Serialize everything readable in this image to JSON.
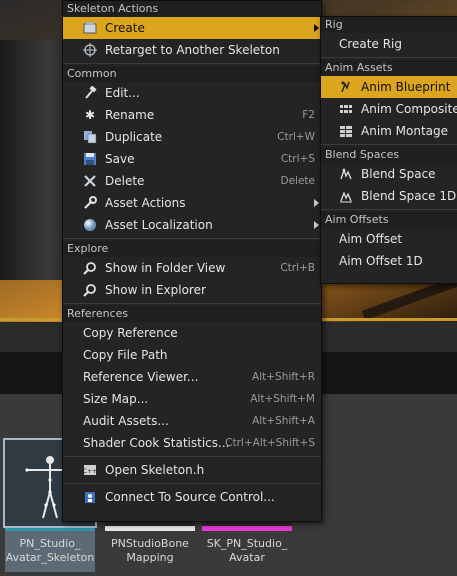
{
  "menu": {
    "sections": {
      "skeleton_actions": "Skeleton Actions",
      "common": "Common",
      "explore": "Explore",
      "references": "References"
    },
    "skeleton_actions": [
      {
        "label": "Create",
        "icon": "create-icon",
        "highlighted": true,
        "submenu": true
      },
      {
        "label": "Retarget to Another Skeleton",
        "icon": "crosshair-icon"
      }
    ],
    "common": [
      {
        "label": "Edit...",
        "icon": "hammer-icon",
        "shortcut": ""
      },
      {
        "label": "Rename",
        "icon": "asterisk-icon",
        "shortcut": "F2"
      },
      {
        "label": "Duplicate",
        "icon": "duplicate-icon",
        "shortcut": "Ctrl+W"
      },
      {
        "label": "Save",
        "icon": "save-icon",
        "shortcut": "Ctrl+S"
      },
      {
        "label": "Delete",
        "icon": "delete-icon",
        "shortcut": "Delete"
      },
      {
        "label": "Asset Actions",
        "icon": "wrench-icon",
        "submenu": true
      },
      {
        "label": "Asset Localization",
        "icon": "globe-icon",
        "submenu": true
      }
    ],
    "explore": [
      {
        "label": "Show in Folder View",
        "icon": "magnifier-icon",
        "shortcut": "Ctrl+B"
      },
      {
        "label": "Show in Explorer",
        "icon": "magnifier-icon",
        "shortcut": ""
      }
    ],
    "references": [
      {
        "label": "Copy Reference",
        "shortcut": ""
      },
      {
        "label": "Copy File Path",
        "shortcut": ""
      },
      {
        "label": "Reference Viewer...",
        "shortcut": "Alt+Shift+R"
      },
      {
        "label": "Size Map...",
        "shortcut": "Alt+Shift+M"
      },
      {
        "label": "Audit Assets...",
        "shortcut": "Alt+Shift+A"
      },
      {
        "label": "Shader Cook Statistics...",
        "shortcut": "Ctrl+Alt+Shift+S"
      }
    ],
    "open_header": {
      "label": "Open Skeleton.h",
      "icon": "cpp-file-icon"
    },
    "source_control": {
      "label": "Connect To Source Control...",
      "icon": "source-control-icon"
    }
  },
  "submenu": {
    "rig_header": "Rig",
    "rig_items": [
      {
        "label": "Create Rig"
      }
    ],
    "anim_assets_header": "Anim Assets",
    "anim_assets_items": [
      {
        "label": "Anim Blueprint",
        "icon": "anim-blueprint-icon",
        "highlighted": true
      },
      {
        "label": "Anim Composite",
        "icon": "anim-composite-icon"
      },
      {
        "label": "Anim Montage",
        "icon": "anim-montage-icon"
      }
    ],
    "blend_spaces_header": "Blend Spaces",
    "blend_spaces_items": [
      {
        "label": "Blend Space",
        "icon": "blend-space-icon"
      },
      {
        "label": "Blend Space 1D",
        "icon": "blend-space-1d-icon"
      }
    ],
    "aim_offsets_header": "Aim Offsets",
    "aim_offsets_items": [
      {
        "label": "Aim Offset"
      },
      {
        "label": "Aim Offset 1D"
      }
    ]
  },
  "assets": [
    {
      "name_line1": "PN_Studio_",
      "name_line2": "Avatar_Skeleton",
      "selected": true,
      "color": "#2b96a9"
    },
    {
      "name_line1": "PNStudioBone",
      "name_line2": "Mapping",
      "selected": false,
      "color": "#e6e6e6"
    },
    {
      "name_line1": "SK_PN_Studio_",
      "name_line2": "Avatar",
      "selected": false,
      "color": "#e83ad6"
    }
  ],
  "colors": {
    "highlight": "#dca51e",
    "menu_bg": "#242424"
  }
}
